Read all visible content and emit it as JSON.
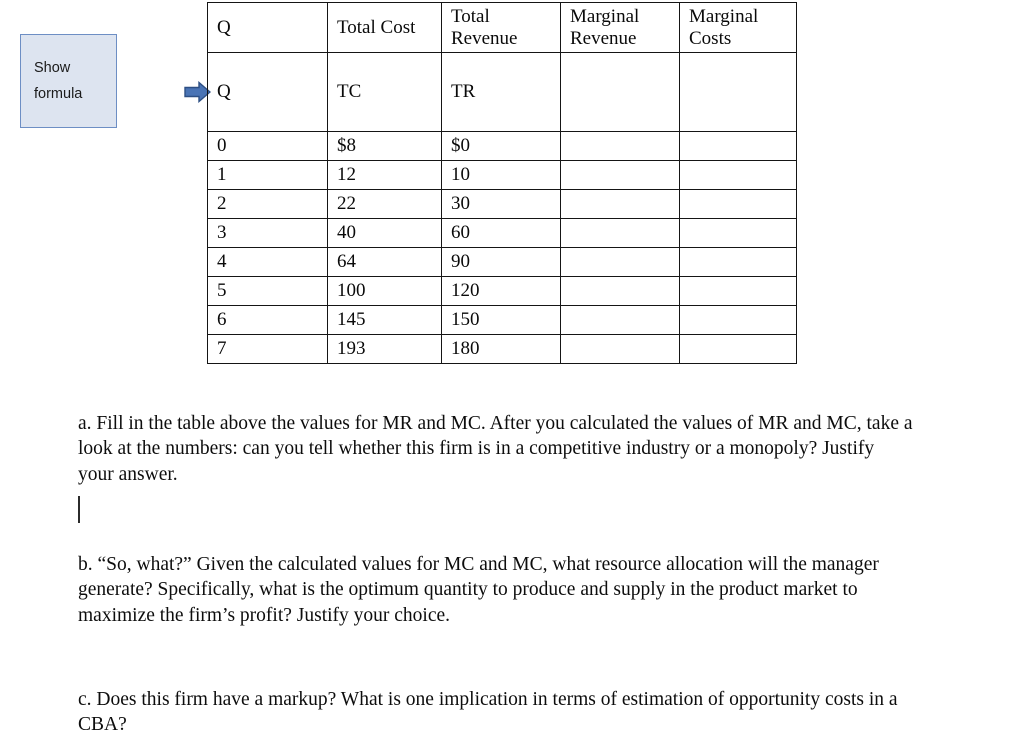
{
  "callout": {
    "name": "show-formula",
    "line1": "Show",
    "line2": "formula",
    "fill_color": "#dde4f0",
    "border_color": "#6d8ec4"
  },
  "pointer": {
    "icon": "right-arrow-icon",
    "fill_color": "#4a74b5",
    "stroke_color": "#2d4f84"
  },
  "table": {
    "headers": {
      "quantity": "Q",
      "total_cost": "Total Cost",
      "total_revenue_line1": "Total",
      "total_revenue_line2": "Revenue",
      "marginal_revenue_line1": "Marginal",
      "marginal_revenue_line2": "Revenue",
      "marginal_costs_line1": "Marginal",
      "marginal_costs_line2": "Costs"
    },
    "symbols": {
      "quantity": "Q",
      "total_cost": "TC",
      "total_revenue": "TR",
      "marginal_revenue": "",
      "marginal_costs": ""
    },
    "rows": [
      {
        "q": "0",
        "tc": "$8",
        "tr": "$0",
        "mr": "",
        "mc": ""
      },
      {
        "q": "1",
        "tc": "12",
        "tr": "10",
        "mr": "",
        "mc": ""
      },
      {
        "q": "2",
        "tc": "22",
        "tr": "30",
        "mr": "",
        "mc": ""
      },
      {
        "q": "3",
        "tc": "40",
        "tr": "60",
        "mr": "",
        "mc": ""
      },
      {
        "q": "4",
        "tc": "64",
        "tr": "90",
        "mr": "",
        "mc": ""
      },
      {
        "q": "5",
        "tc": "100",
        "tr": "120",
        "mr": "",
        "mc": ""
      },
      {
        "q": "6",
        "tc": "145",
        "tr": "150",
        "mr": "",
        "mc": ""
      },
      {
        "q": "7",
        "tc": "193",
        "tr": "180",
        "mr": "",
        "mc": ""
      }
    ]
  },
  "questions": {
    "a": "a. Fill in the table above the values for MR and MC. After you calculated the values of MR and MC, take a look at the numbers: can you tell whether this firm is in a competitive industry or a monopoly? Justify your answer.",
    "b": "b. “So, what?” Given the calculated values for MC and MC, what resource allocation will the manager generate? Specifically, what is the optimum quantity to produce and supply in the product market to maximize the firm’s profit? Justify your choice.",
    "c": "c. Does this firm have a markup? What is one implication in terms of estimation of opportunity costs in a CBA?"
  }
}
